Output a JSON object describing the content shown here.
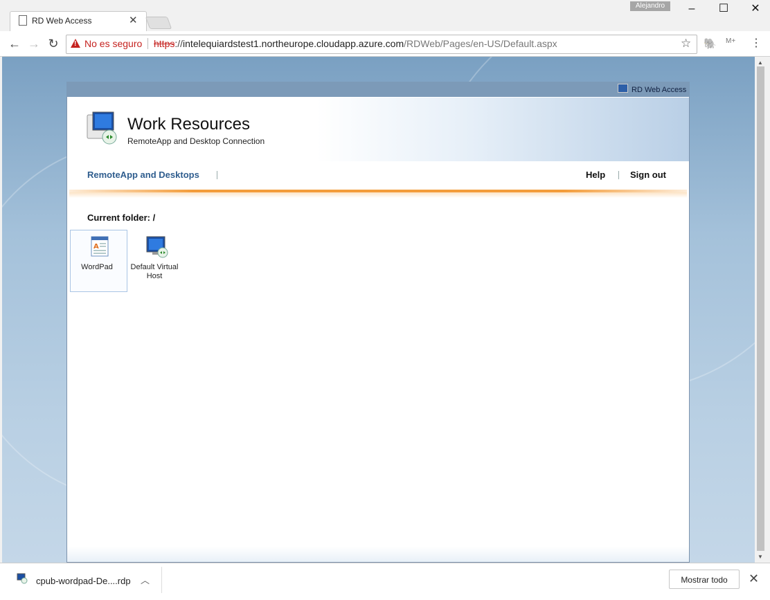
{
  "browser": {
    "tab_title": "RD Web Access",
    "profile_name": "Alejandro",
    "security_label": "No es seguro",
    "url_scheme": "https",
    "url_sep": "://",
    "url_host": "intelequiardstest1.northeurope.cloudapp.azure.com",
    "url_path": "/RDWeb/Pages/en-US/Default.aspx",
    "extension_mv": "M+",
    "icons": [
      "page-icon",
      "close-icon",
      "back-icon",
      "forward-icon",
      "reload-icon",
      "warning-icon",
      "star-icon",
      "evernote-icon",
      "menu-icon",
      "minimize-icon",
      "maximize-icon"
    ]
  },
  "page": {
    "brand_label": "RD Web Access",
    "title": "Work Resources",
    "subtitle": "RemoteApp and Desktop Connection",
    "nav": {
      "remoteapp": "RemoteApp and Desktops",
      "help": "Help",
      "signout": "Sign out"
    },
    "current_folder": "Current folder: /",
    "apps": [
      {
        "label": "WordPad",
        "icon": "wordpad-icon"
      },
      {
        "label": "Default Virtual Host",
        "icon": "virtual-desktop-icon"
      }
    ]
  },
  "downloads": {
    "file_name": "cpub-wordpad-De....rdp",
    "show_all": "Mostrar todo"
  },
  "colors": {
    "insecure": "#c5221f",
    "nav_link": "#2f5d8e",
    "accent_orange": "#f39c3a",
    "page_bg": "#a4c1da"
  }
}
